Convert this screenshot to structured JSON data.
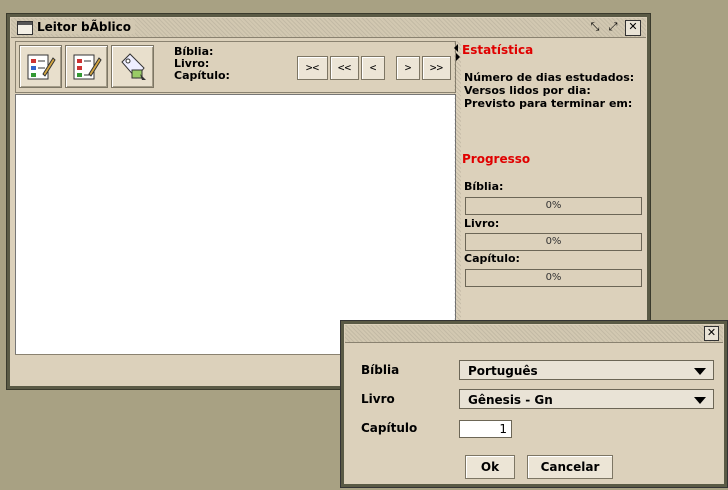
{
  "main_window": {
    "title": "Leitor bÃ­blico",
    "info_labels": {
      "biblia": "Bíblia:",
      "livro": "Livro:",
      "capitulo": "Capítulo:"
    },
    "nav_buttons": [
      ">< ",
      "<<",
      "<",
      ">",
      ">>"
    ],
    "tool_icons": [
      "edit-checklist-icon",
      "edit-list-icon",
      "tag-icon"
    ]
  },
  "stats": {
    "heading": "Estatística",
    "lines": [
      "Número de dias estudados:",
      "Versos lidos por dia:",
      "Previsto para terminar em:"
    ],
    "progress_heading": "Progresso",
    "progress": [
      {
        "label": "Bíblia:",
        "value": "0%",
        "fraction": 0
      },
      {
        "label": "Livro:",
        "value": "0%",
        "fraction": 0
      },
      {
        "label": "Capítulo:",
        "value": "0%",
        "fraction": 0
      }
    ],
    "accent_color": "#e00000"
  },
  "dialog": {
    "labels": {
      "biblia": "Bíblia",
      "livro": "Livro",
      "capitulo": "Capítulo"
    },
    "biblia_value": "Português",
    "livro_value": "Gênesis - Gn",
    "capitulo_value": "1",
    "ok_label": "Ok",
    "cancel_label": "Cancelar"
  }
}
